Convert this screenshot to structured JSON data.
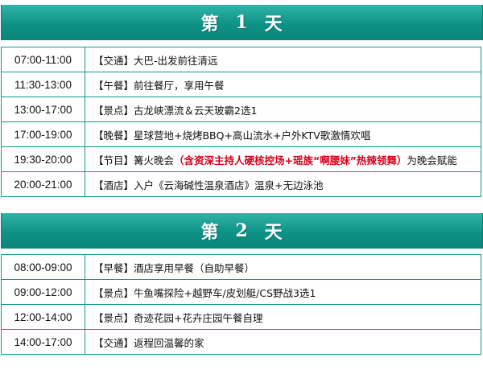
{
  "days": [
    {
      "header": {
        "pre": "第",
        "num": "1",
        "post": "天"
      },
      "rows": [
        {
          "time": "07:00-11:00",
          "text": "【交通】大巴-出发前往清远",
          "highlight": "",
          "after": ""
        },
        {
          "time": "11:30-13:00",
          "text": "【午餐】前往餐厅，享用午餐",
          "highlight": "",
          "after": ""
        },
        {
          "time": "13:00-17:00",
          "text": "【景点】古龙峡漂流＆云天玻霸2选1",
          "highlight": "",
          "after": ""
        },
        {
          "time": "17:00-19:00",
          "text": "【晚餐】星球营地+烧烤BBQ+高山流水+户外KTV歌激情欢唱",
          "highlight": "",
          "after": ""
        },
        {
          "time": "19:30-20:00",
          "text": "【节目】篝火晚会",
          "highlight": "（含资深主持人硬核控场+瑶族“啊腰妹”热辣领舞）",
          "after": "为晚会赋能"
        },
        {
          "time": "20:00-21:00",
          "text": "【酒店】入户《云海碱性温泉酒店》温泉+无边泳池",
          "highlight": "",
          "after": ""
        }
      ]
    },
    {
      "header": {
        "pre": "第",
        "num": "2",
        "post": "天"
      },
      "rows": [
        {
          "time": "08:00-09:00",
          "text": "【早餐】酒店享用早餐（自助早餐）",
          "highlight": "",
          "after": ""
        },
        {
          "time": "09:00-12:00",
          "text": "【景点】牛鱼嘴探险+越野车/皮划艇/CS野战3选1",
          "highlight": "",
          "after": ""
        },
        {
          "time": "12:00-14:00",
          "text": "【景点】奇迹花园+花卉庄园午餐自理",
          "highlight": "",
          "after": ""
        },
        {
          "time": "14:00-17:00",
          "text": "【交通】返程回温馨的家",
          "highlight": "",
          "after": ""
        }
      ]
    }
  ],
  "colors": {
    "header_teal": "#0f9286",
    "border_teal": "#13978b",
    "highlight_red": "#d6001c"
  }
}
